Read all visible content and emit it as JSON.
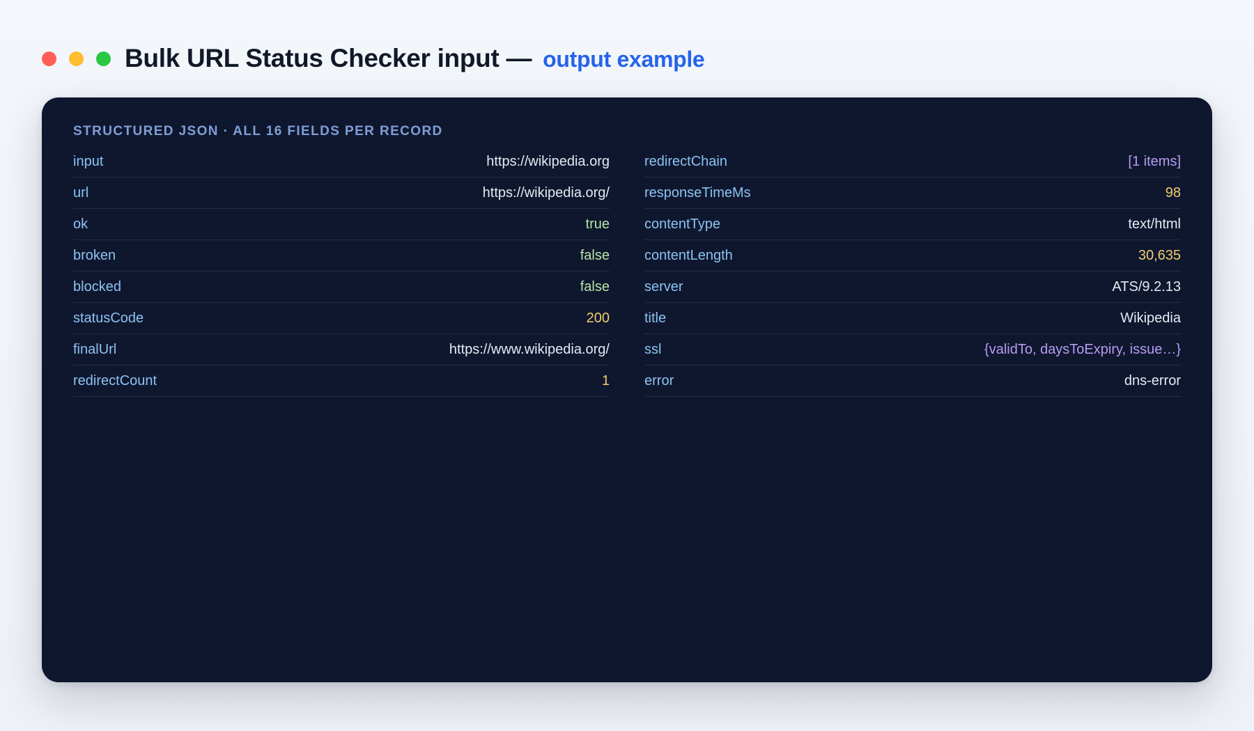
{
  "window": {
    "title": "Bulk URL Status Checker input —",
    "title_accent": "output example",
    "controls": {
      "close_color": "#ff5f57",
      "minimize_color": "#febc2e",
      "maximize_color": "#28c840"
    }
  },
  "panel": {
    "label": "STRUCTURED JSON · ALL 16 FIELDS PER RECORD",
    "left_fields": [
      {
        "key": "input",
        "value": "https://wikipedia.org",
        "kind": "str"
      },
      {
        "key": "url",
        "value": "https://wikipedia.org/",
        "kind": "str"
      },
      {
        "key": "ok",
        "value": "true",
        "kind": "bool"
      },
      {
        "key": "broken",
        "value": "false",
        "kind": "bool"
      },
      {
        "key": "blocked",
        "value": "false",
        "kind": "bool"
      },
      {
        "key": "statusCode",
        "value": "200",
        "kind": "num"
      },
      {
        "key": "finalUrl",
        "value": "https://www.wikipedia.org/",
        "kind": "str"
      },
      {
        "key": "redirectCount",
        "value": "1",
        "kind": "num"
      }
    ],
    "right_fields": [
      {
        "key": "redirectChain",
        "value": "[1 items]",
        "kind": "obj"
      },
      {
        "key": "responseTimeMs",
        "value": "98",
        "kind": "num"
      },
      {
        "key": "contentType",
        "value": "text/html",
        "kind": "str"
      },
      {
        "key": "contentLength",
        "value": "30,635",
        "kind": "num"
      },
      {
        "key": "server",
        "value": "ATS/9.2.13",
        "kind": "str"
      },
      {
        "key": "title",
        "value": "Wikipedia",
        "kind": "str"
      },
      {
        "key": "ssl",
        "value": "{validTo, daysToExpiry, issue…}",
        "kind": "obj"
      },
      {
        "key": "error",
        "value": "dns-error",
        "kind": "str"
      }
    ]
  }
}
